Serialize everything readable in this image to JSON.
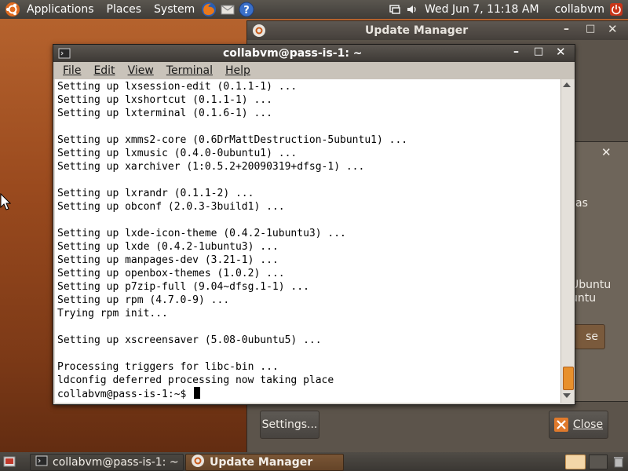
{
  "top_panel": {
    "menus": [
      "Applications",
      "Places",
      "System"
    ],
    "clock": "Wed Jun  7, 11:18 AM",
    "user": "collabvm"
  },
  "update_manager": {
    "title": "Update Manager",
    "settings_button": "Settings...",
    "close_button": "Close",
    "partial_text_1": "as",
    "partial_text_2": "Ubuntu",
    "partial_text_3": "untu",
    "partial_button": "se"
  },
  "terminal": {
    "title": "collabvm@pass-is-1: ~",
    "menu": [
      "File",
      "Edit",
      "View",
      "Terminal",
      "Help"
    ],
    "lines": [
      "Setting up lxsession-edit (0.1.1-1) ...",
      "Setting up lxshortcut (0.1.1-1) ...",
      "Setting up lxterminal (0.1.6-1) ...",
      "",
      "Setting up xmms2-core (0.6DrMattDestruction-5ubuntu1) ...",
      "Setting up lxmusic (0.4.0-0ubuntu1) ...",
      "Setting up xarchiver (1:0.5.2+20090319+dfsg-1) ...",
      "",
      "Setting up lxrandr (0.1.1-2) ...",
      "Setting up obconf (2.0.3-3build1) ...",
      "",
      "Setting up lxde-icon-theme (0.4.2-1ubuntu3) ...",
      "Setting up lxde (0.4.2-1ubuntu3) ...",
      "Setting up manpages-dev (3.21-1) ...",
      "Setting up openbox-themes (1.0.2) ...",
      "Setting up p7zip-full (9.04~dfsg.1-1) ...",
      "Setting up rpm (4.7.0-9) ...",
      "Trying rpm init...",
      "",
      "Setting up xscreensaver (5.08-0ubuntu5) ...",
      "",
      "Processing triggers for libc-bin ...",
      "ldconfig deferred processing now taking place"
    ],
    "prompt": "collabvm@pass-is-1:~$"
  },
  "taskbar": {
    "items": [
      "collabvm@pass-is-1: ~",
      "Update Manager"
    ]
  },
  "colors": {
    "accent_orange": "#e8902c",
    "panel_dark": "#3f3c38",
    "desktop_brown": "#9a4a1e"
  }
}
